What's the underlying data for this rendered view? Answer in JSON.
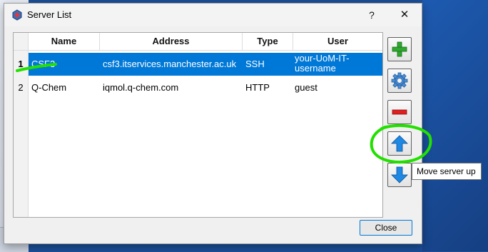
{
  "window": {
    "title": "Server List",
    "help_label": "?",
    "close_label": "✕"
  },
  "table": {
    "columns": [
      "Name",
      "Address",
      "Type",
      "User"
    ],
    "rows": [
      {
        "num": "1",
        "name": "CSF3",
        "address": "csf3.itservices.manchester.ac.uk",
        "type": "SSH",
        "user": "your-UoM-IT-username",
        "selected": true
      },
      {
        "num": "2",
        "name": "Q-Chem",
        "address": "iqmol.q-chem.com",
        "type": "HTTP",
        "user": "guest",
        "selected": false
      }
    ]
  },
  "side_buttons": [
    "plus-icon",
    "gear-icon",
    "minus-icon",
    "arrow-up-icon",
    "arrow-down-icon"
  ],
  "tooltip": {
    "text": "Move server up"
  },
  "footer": {
    "close_label": "Close"
  },
  "colors": {
    "selection": "#0078d7",
    "annotation": "#22e000",
    "add_green": "#2fa82f",
    "remove_red": "#e02020",
    "arrow_blue": "#1e88e5"
  }
}
